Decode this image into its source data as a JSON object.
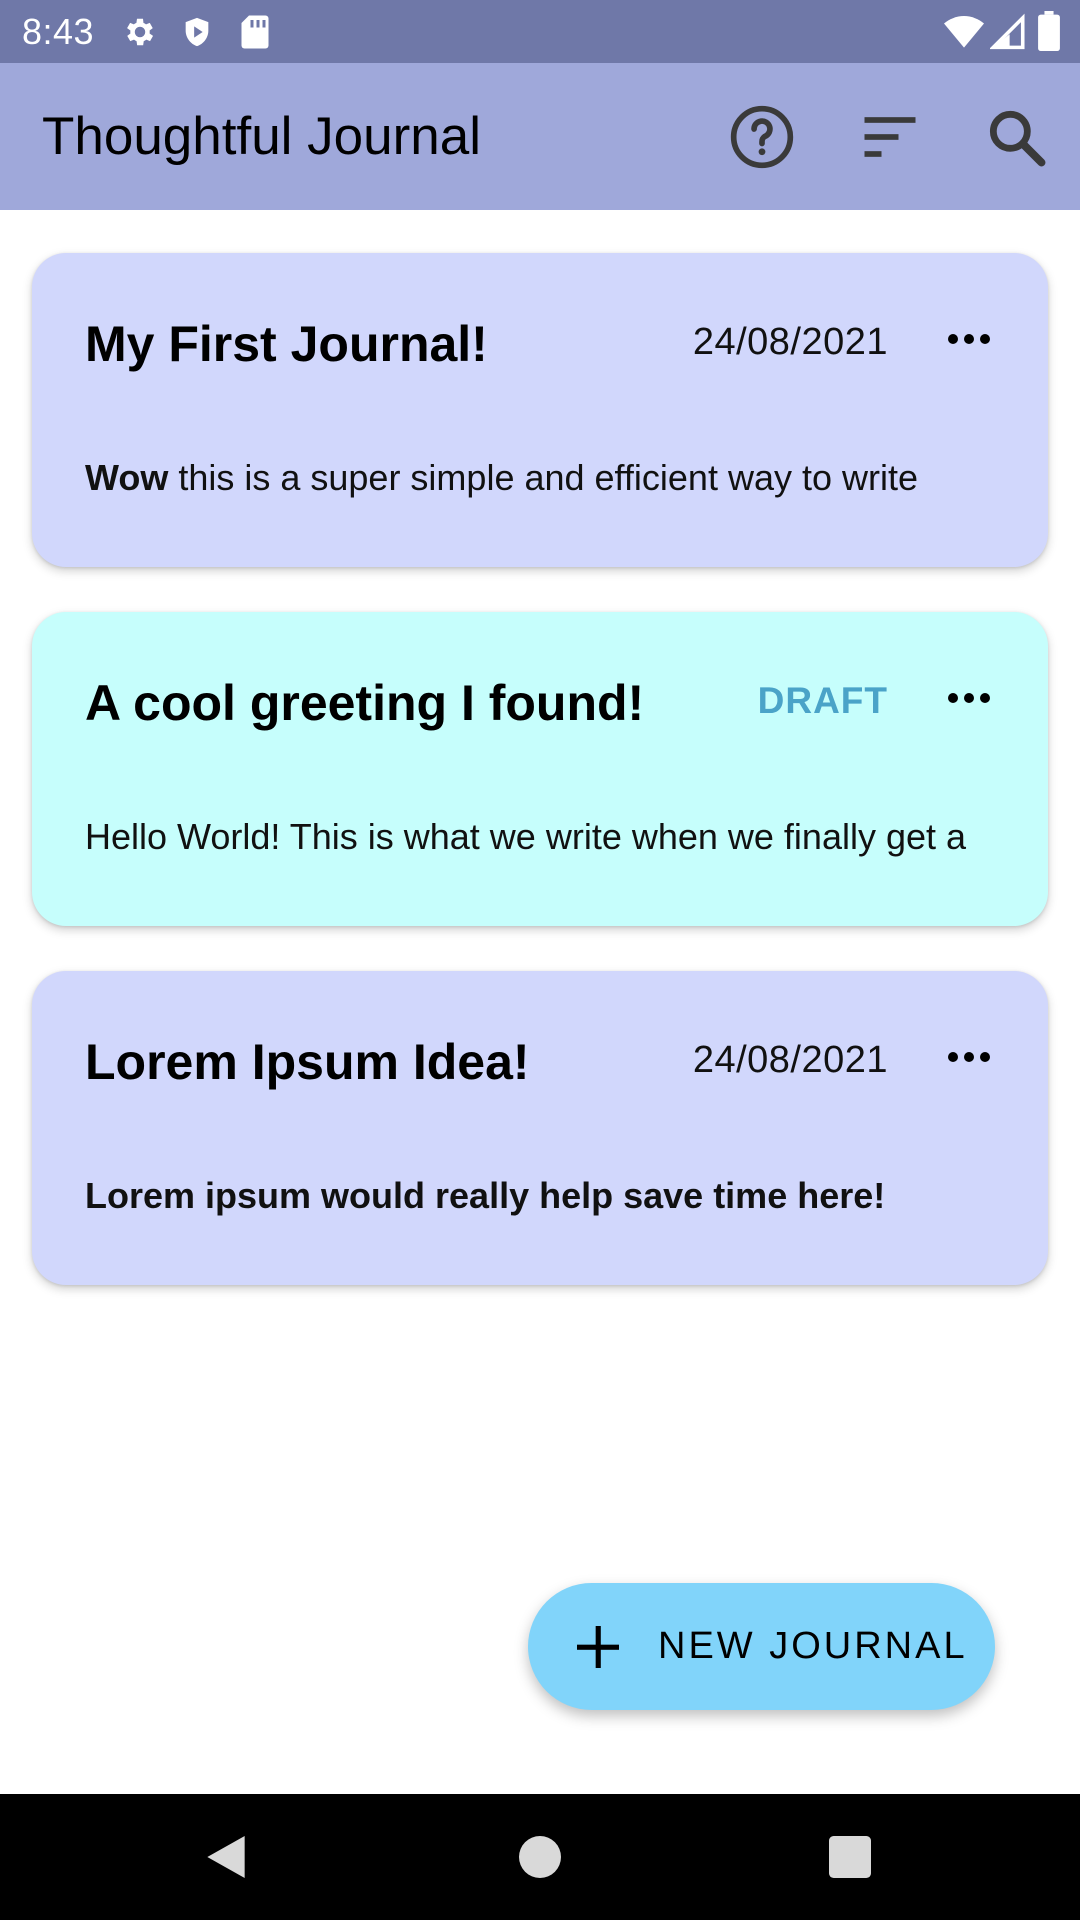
{
  "status_bar": {
    "time": "8:43",
    "icons_left": [
      "gear-icon",
      "shield-icon",
      "sd-card-icon"
    ],
    "icons_right": [
      "wifi-icon",
      "signal-icon",
      "battery-icon"
    ]
  },
  "app_bar": {
    "title": "Thoughtful Journal",
    "background": "#9fa8da",
    "actions": [
      "help-icon",
      "sort-icon",
      "search-icon"
    ]
  },
  "journals": [
    {
      "title": "My First Journal!",
      "date": "24/08/2021",
      "body_bold": "Wow",
      "body_rest": " this is a super simple and efficient way to write",
      "background": "#d1d7fc"
    },
    {
      "title": "A cool greeting I found!",
      "status": "DRAFT",
      "body": "Hello World! This is what we write when we finally get a",
      "background": "#c6fefc"
    },
    {
      "title": "Lorem Ipsum Idea!",
      "date": "24/08/2021",
      "body": "Lorem ipsum would really help save time here!",
      "background": "#d1d7fc"
    }
  ],
  "fab": {
    "label": "NEW JOURNAL",
    "icon": "plus-icon",
    "background": "#81d4fa"
  },
  "nav_bar": {
    "buttons": [
      "back-icon",
      "home-icon",
      "recents-icon"
    ]
  }
}
